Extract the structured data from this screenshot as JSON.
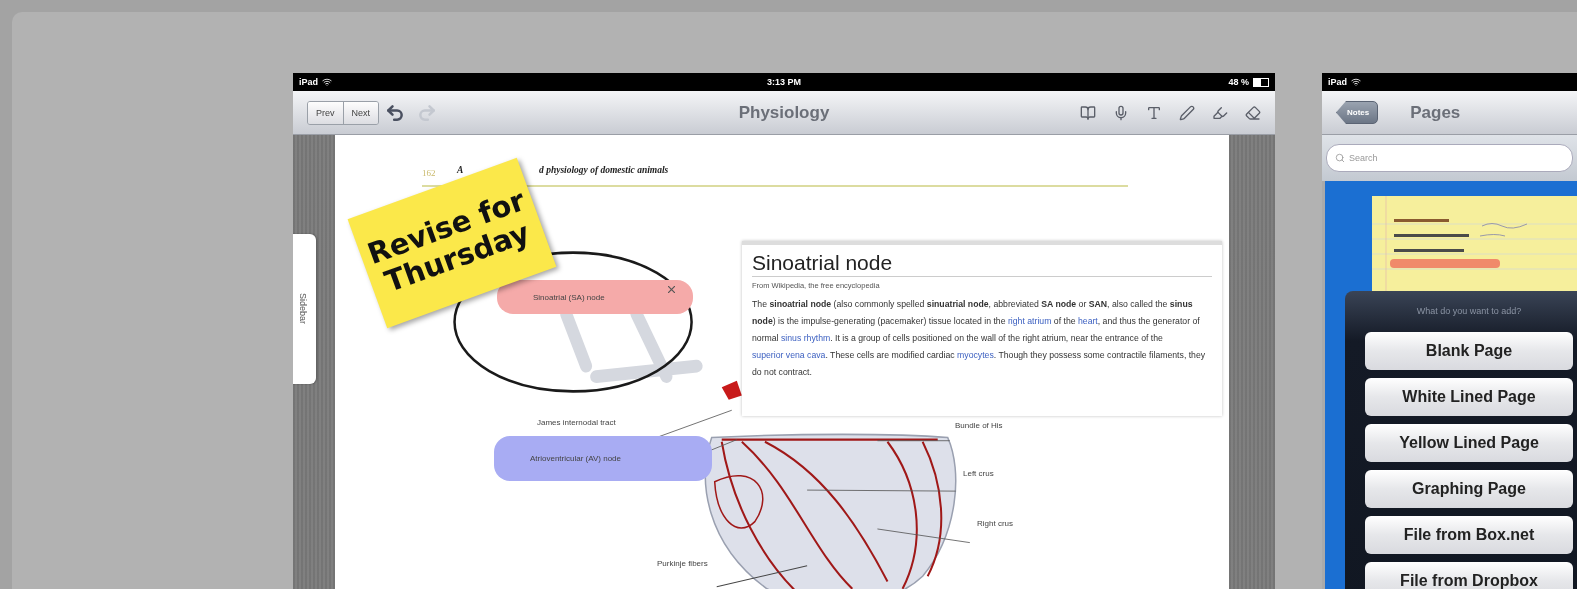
{
  "left_screen": {
    "status_bar": {
      "device": "iPad",
      "time": "3:13 PM",
      "battery": "48 %"
    },
    "toolbar": {
      "nav_buttons": [
        "Prev",
        "Next"
      ],
      "history_buttons": [
        {
          "kind": "undo",
          "disabled": false
        },
        {
          "kind": "redo",
          "disabled": true
        }
      ],
      "title": "Physiology"
    },
    "sidebar_tab": "Sidebar",
    "page": {
      "page_number": "162",
      "header_parts": [
        "A",
        "d physiology of domestic animals"
      ],
      "sticky_note": "Revise for Thursday",
      "highlights": [
        {
          "label": "Sinoatrial (SA) node",
          "color": "#f5aaa9",
          "closable": true
        },
        {
          "label": "Atrioventricular (AV) node",
          "color": "#a8acf3",
          "closable": false
        }
      ],
      "figure_labels": [
        "James internodal tract",
        "Purkinje fibers",
        "Bundle of His",
        "Left crus",
        "Right crus"
      ],
      "wiki_popup": {
        "title": "Sinoatrial node",
        "source": "From Wikipedia, the free encyclopedia",
        "paragraph": [
          {
            "kind": "text",
            "text": "The **sinoatrial node** (also commonly spelled **sinuatrial node**, abbreviated **SA node** or **SAN**, also called the **sinus node**) is the impulse-generating (pacemaker) tissue located in the "
          },
          {
            "kind": "link",
            "text": "right atrium"
          },
          {
            "kind": "text",
            "text": " of the "
          },
          {
            "kind": "link",
            "text": "heart"
          },
          {
            "kind": "text",
            "text": ", and thus the generator of normal "
          },
          {
            "kind": "link",
            "text": "sinus rhythm"
          },
          {
            "kind": "text",
            "text": ". It is a group of cells positioned on the wall of the right atrium, near the entrance of the "
          },
          {
            "kind": "link",
            "text": "superior vena cava"
          },
          {
            "kind": "text",
            "text": ". These cells are modified cardiac "
          },
          {
            "kind": "link",
            "text": "myocytes"
          },
          {
            "kind": "text",
            "text": ". Though they possess some contractile filaments, they do not contract."
          }
        ]
      }
    }
  },
  "right_screen": {
    "status_bar": {
      "device": "iPad"
    },
    "nav": {
      "back": "Notes",
      "title": "Pages"
    },
    "search": {
      "placeholder": "Search"
    },
    "action_sheet": {
      "prompt": "What do you want to add?",
      "options": [
        "Blank Page",
        "White Lined Page",
        "Yellow Lined Page",
        "Graphing Page",
        "File from Box.net",
        "File from Dropbox"
      ]
    }
  }
}
